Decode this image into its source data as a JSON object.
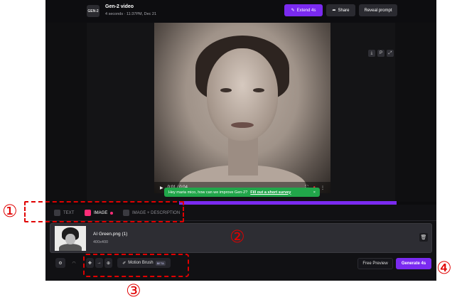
{
  "header": {
    "badge": "GEN-2",
    "title": "Gen-2 video",
    "subtitle": "4 seconds · 11:37PM, Dec 21",
    "extend_label": "Extend 4s",
    "share_label": "Share",
    "reveal_label": "Reveal prompt"
  },
  "player": {
    "time": "0:01 / 0:04"
  },
  "survey": {
    "message": "Hey maria mico, how can we improve Gen-2?",
    "link": "Fill out a short survey",
    "close": "×"
  },
  "tabs": [
    {
      "label": "TEXT"
    },
    {
      "label": "IMAGE"
    },
    {
      "label": "IMAGE + DESCRIPTION"
    }
  ],
  "asset": {
    "name": "AI Green.png (1)",
    "size": "400x400"
  },
  "toolbar": {
    "motion_brush_label": "Motion Brush",
    "beta": "BETA",
    "free_preview_label": "Free Preview",
    "generate_label": "Generate 4s"
  },
  "annotations": {
    "n1": "①",
    "n2": "②",
    "n3": "③",
    "n4": "④"
  },
  "colors": {
    "accent": "#7a2af0",
    "survey_bg": "#21a64a",
    "annotation": "#e00000",
    "image_tab_dot": "#ff2d78"
  }
}
